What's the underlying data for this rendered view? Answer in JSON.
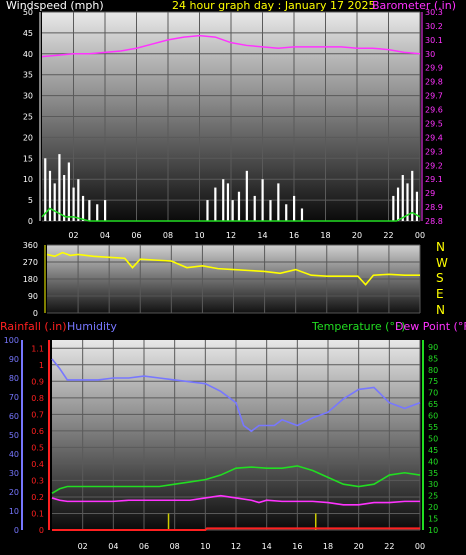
{
  "header": {
    "windspeed_label": "Windspeed (mph)",
    "title": "24 hour graph day : January 17 2025",
    "barometer_label": "Barometer (.in)"
  },
  "lower_header": {
    "rainfall_label": "Rainfall (.in)",
    "humidity_label": "Humidity",
    "temperature_label": "Temperature (°F)",
    "dewpoint_label": "Dew Point (°F)"
  },
  "compass": [
    "N",
    "W",
    "S",
    "E",
    "N"
  ],
  "colors": {
    "title": "#ffff00",
    "barometer": "#ff33ff",
    "wind_gust": "#ffffff",
    "wind_avg": "#22dd22",
    "direction": "#ffff00",
    "rain": "#ff2020",
    "humidity": "#7777ff",
    "temperature": "#22dd22",
    "dewpoint": "#ff33ff",
    "rain_tick": "#cccc00"
  },
  "chart_data": [
    {
      "type": "line",
      "name": "wind_barometer",
      "categories": [
        "02",
        "04",
        "06",
        "08",
        "10",
        "12",
        "14",
        "16",
        "18",
        "20",
        "22",
        "00"
      ],
      "ylabel": "Windspeed (mph)",
      "y2label": "Barometer (.in)",
      "ylim": [
        0,
        50
      ],
      "yticks": [
        0,
        5,
        10,
        15,
        20,
        25,
        30,
        35,
        40,
        45,
        50
      ],
      "y2lim": [
        28.8,
        30.3
      ],
      "y2ticks": [
        28.8,
        28.9,
        29.0,
        29.1,
        29.2,
        29.3,
        29.4,
        29.5,
        29.6,
        29.7,
        29.8,
        29.9,
        30.0,
        30.1,
        30.2,
        30.3
      ],
      "y2ticklabels": [
        "28.8",
        "28.9",
        "29",
        "29.1",
        "29.2",
        "29.3",
        "29.4",
        "29.5",
        "29.6",
        "29.7",
        "29.8",
        "29.9",
        "30",
        "30.1",
        "30.2",
        "30.3"
      ],
      "barometer": {
        "x": [
          0,
          1,
          2,
          3,
          4,
          5,
          6,
          7,
          8,
          9,
          10,
          11,
          12,
          13,
          14,
          15,
          16,
          17,
          18,
          19,
          20,
          21,
          22,
          23,
          24
        ],
        "y": [
          29.98,
          29.99,
          30.0,
          30.0,
          30.01,
          30.02,
          30.04,
          30.07,
          30.1,
          30.12,
          30.13,
          30.12,
          30.08,
          30.06,
          30.05,
          30.04,
          30.05,
          30.05,
          30.05,
          30.05,
          30.04,
          30.04,
          30.03,
          30.01,
          30.0
        ]
      },
      "wind_gust": {
        "x": [
          0.2,
          0.5,
          0.8,
          1.1,
          1.4,
          1.7,
          2.0,
          2.3,
          2.6,
          3.0,
          3.5,
          4.0,
          10.5,
          11.0,
          11.5,
          11.8,
          12.1,
          12.5,
          13.0,
          13.5,
          14.0,
          14.5,
          15.0,
          15.5,
          16.0,
          16.5,
          22.3,
          22.6,
          22.9,
          23.2,
          23.5,
          23.8
        ],
        "y": [
          15,
          12,
          9,
          16,
          11,
          14,
          8,
          10,
          6,
          5,
          4,
          5,
          5,
          8,
          10,
          9,
          5,
          7,
          12,
          6,
          10,
          5,
          9,
          4,
          6,
          3,
          6,
          8,
          11,
          9,
          12,
          7
        ]
      },
      "wind_avg": {
        "x": [
          0,
          0.5,
          1.0,
          1.5,
          2.0,
          2.5,
          3.0,
          22.5,
          23.0,
          23.5,
          24
        ],
        "y": [
          1,
          3,
          2,
          1,
          1,
          0.5,
          0,
          0,
          1,
          2,
          1
        ]
      }
    },
    {
      "type": "line",
      "name": "wind_direction",
      "categories": [
        "02",
        "04",
        "06",
        "08",
        "10",
        "12",
        "14",
        "16",
        "18",
        "20",
        "22",
        "00"
      ],
      "ylim": [
        0,
        360
      ],
      "yticks": [
        0,
        90,
        180,
        270,
        360
      ],
      "x": [
        0,
        0.5,
        1,
        1.5,
        2,
        3,
        4,
        5,
        5.5,
        6,
        7,
        8,
        9,
        10,
        11,
        12,
        13,
        14,
        15,
        16,
        17,
        18,
        19,
        20,
        20.5,
        21,
        22,
        23,
        24
      ],
      "y": [
        310,
        300,
        320,
        305,
        310,
        300,
        295,
        290,
        240,
        285,
        280,
        275,
        240,
        250,
        235,
        230,
        225,
        220,
        210,
        230,
        200,
        195,
        195,
        195,
        150,
        200,
        205,
        200,
        200
      ]
    },
    {
      "type": "line",
      "name": "rain_humidity_temperature",
      "categories": [
        "02",
        "04",
        "06",
        "08",
        "10",
        "12",
        "14",
        "16",
        "18",
        "20",
        "22",
        "00"
      ],
      "rain_ticks": [
        0,
        0.1,
        0.2,
        0.3,
        0.4,
        0.5,
        0.6,
        0.7,
        0.8,
        0.9,
        1.0,
        1.1
      ],
      "rain_ticklabels": [
        "0",
        "0.1",
        "0.2",
        "0.3",
        "0.4",
        "0.5",
        "0.6",
        "0.7",
        "0.8",
        "0.9",
        "1",
        "1.1"
      ],
      "humidity_ticks": [
        0,
        10,
        20,
        30,
        40,
        50,
        60,
        70,
        80,
        90,
        100
      ],
      "temp_ticks": [
        10,
        15,
        20,
        25,
        30,
        35,
        40,
        45,
        50,
        55,
        60,
        65,
        70,
        75,
        80,
        85,
        90
      ],
      "rainfall": {
        "x": [
          0,
          10,
          10.1,
          24
        ],
        "y": [
          0,
          0,
          0.01,
          0.01
        ]
      },
      "humidity": {
        "x": [
          0,
          0.5,
          1,
          2,
          3,
          4,
          5,
          6,
          7,
          8,
          9,
          10,
          11,
          12,
          12.5,
          13,
          13.5,
          14,
          14.5,
          15,
          16,
          17,
          18,
          19,
          20,
          21,
          22,
          23,
          24
        ],
        "y": [
          90,
          85,
          79,
          79,
          79,
          80,
          80,
          81,
          80,
          79,
          78,
          77,
          73,
          67,
          55,
          52,
          55,
          55,
          55,
          58,
          55,
          59,
          62,
          69,
          74,
          75,
          67,
          64,
          67
        ]
      },
      "temperature": {
        "x": [
          0,
          0.5,
          1,
          2,
          3,
          4,
          5,
          6,
          7,
          8,
          9,
          10,
          11,
          12,
          13,
          14,
          15,
          16,
          17,
          18,
          19,
          20,
          21,
          22,
          23,
          24
        ],
        "y": [
          26,
          28,
          29,
          29,
          29,
          29,
          29,
          29,
          29,
          30,
          31,
          32,
          34,
          37,
          37.5,
          37,
          37,
          38,
          36,
          33,
          30,
          29,
          30,
          34,
          35,
          34
        ]
      },
      "dewpoint": {
        "x": [
          0,
          0.5,
          1,
          2,
          3,
          4,
          5,
          6,
          7,
          8,
          9,
          10,
          11,
          12,
          13,
          13.5,
          14,
          15,
          16,
          17,
          18,
          19,
          20,
          21,
          22,
          23,
          24
        ],
        "y": [
          24,
          23,
          22.5,
          22.5,
          22.5,
          22.5,
          23,
          23,
          23,
          23,
          23,
          24,
          25,
          24,
          23,
          22,
          23,
          22.5,
          22.5,
          22.5,
          22,
          21,
          21,
          22,
          22,
          22.5,
          22.5
        ]
      },
      "rain_rate_ticks": {
        "x": [
          7.6,
          17.2
        ],
        "y": [
          0.1,
          0.1
        ]
      }
    }
  ]
}
